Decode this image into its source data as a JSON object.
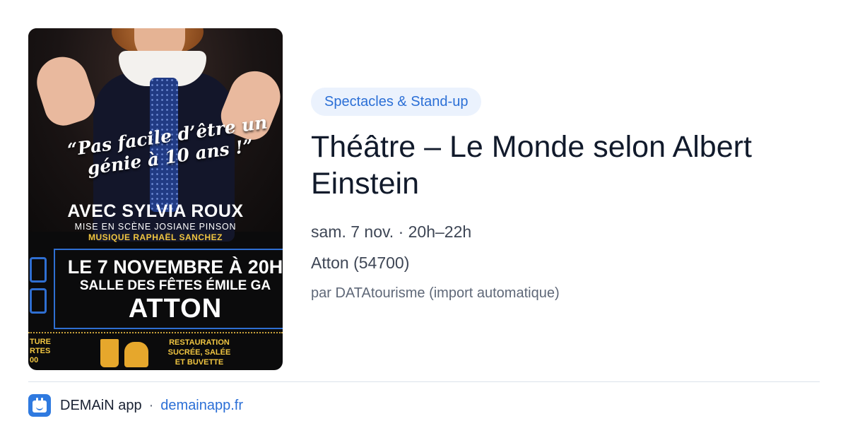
{
  "poster": {
    "quote": "“Pas facile d’être un génie à 10 ans !”",
    "avec": "AVEC SYLVIA ROUX",
    "mise_en_scene": "MISE EN SCÈNE JOSIANE PINSON",
    "musique": "MUSIQUE RAPHAËL SANCHEZ",
    "date_line": "LE 7 NOVEMBRE À 20H",
    "salle_line": "SALLE DES FÊTES ÉMILE GA",
    "city": "ATTON",
    "left_stub": "TURE\nRTES\n00",
    "restauration": "RESTAURATION\nSUCRÉE, SALÉE\nET BUVETTE"
  },
  "event": {
    "category": "Spectacles & Stand-up",
    "title": "Théâtre – Le Monde selon Albert Einstein",
    "date": "sam. 7 nov. · 20h–22h",
    "location": "Atton (54700)",
    "source": "par DATAtourisme (import automatique)"
  },
  "footer": {
    "app_name": "DEMAiN app",
    "separator": "·",
    "url": "demainapp.fr",
    "icon": "calendar-face-icon"
  },
  "colors": {
    "accent": "#2b6fd6",
    "chip_bg": "#ebf2fd",
    "title": "#111a2b",
    "divider": "#dce3ea"
  }
}
